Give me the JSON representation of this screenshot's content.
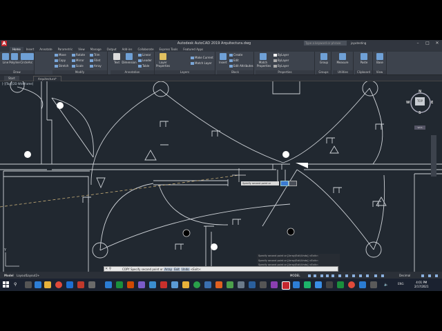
{
  "window": {
    "title": "Autodesk AutoCAD 2019   Arquitectura.dwg",
    "search_placeholder": "Type a keyword or phrase",
    "user": "joyutesting",
    "app_letter": "A"
  },
  "ribbon_tabs": [
    "Home",
    "Insert",
    "Annotate",
    "Parametric",
    "View",
    "Manage",
    "Output",
    "Add-ins",
    "Collaborate",
    "Express Tools",
    "Featured Apps"
  ],
  "ribbon": {
    "draw": {
      "title": "Draw",
      "tools": [
        "Line",
        "Polyline",
        "Circle",
        "Arc"
      ]
    },
    "modify": {
      "title": "Modify",
      "tools": [
        "Move",
        "Rotate",
        "Trim",
        "Copy",
        "Mirror",
        "Fillet",
        "Stretch",
        "Scale",
        "Array"
      ]
    },
    "annotation": {
      "title": "Annotation",
      "tools": [
        "Text",
        "Dimension",
        "Linear",
        "Leader",
        "Table"
      ]
    },
    "layers": {
      "title": "Layers",
      "tools": [
        "Layer Properties",
        "Make Current",
        "Match Layer"
      ]
    },
    "block": {
      "title": "Block",
      "tools": [
        "Insert",
        "Create",
        "Edit",
        "Edit Attributes"
      ]
    },
    "properties": {
      "title": "Properties",
      "tools": [
        "Match Properties",
        "ByLayer",
        "ByLayer",
        "ByLayer"
      ]
    },
    "groups": {
      "title": "Groups",
      "tools": [
        "Group"
      ]
    },
    "utilities": {
      "title": "Utilities",
      "tools": [
        "Measure"
      ]
    },
    "clipboard": {
      "title": "Clipboard",
      "tools": [
        "Paste"
      ]
    },
    "view": {
      "title": "View",
      "tools": [
        "Base"
      ]
    }
  },
  "doc_tabs": {
    "start": "Start",
    "file": "Arquitectura*"
  },
  "viewport_label": "[-][Top][2D Wireframe]",
  "viewcube": {
    "top": "TOP",
    "n": "N",
    "s": "S",
    "e": "E",
    "w": "W",
    "wcs": "WCS"
  },
  "tooltip": {
    "text": "Specify second point or"
  },
  "command_history": [
    "Specify second point or [Array/Exit/Undo] <Exit>:",
    "Specify second point or [Array/Exit/Undo] <Exit>:",
    "Specify second point or [Array/Exit/Undo] <Exit>:"
  ],
  "command_line": {
    "prefix": "COPY Specify second point or",
    "opt1": "Array",
    "opt2": "Exit",
    "opt3": "Undo",
    "suffix": "<Exit>:"
  },
  "layout_tabs": {
    "model": "Model",
    "layout1": "Layout1",
    "layout2": "Layout2",
    "plus": "+"
  },
  "status": {
    "model": "MODEL",
    "scale": "Decimal"
  },
  "taskbar": {
    "time": "4:01 PM",
    "date": "2/17/2021",
    "lang": "ENG"
  },
  "colors": {
    "canvas": "#212830",
    "ribbon": "#3d434d",
    "accent": "#c4262e",
    "taskbar": "#1b2230"
  }
}
